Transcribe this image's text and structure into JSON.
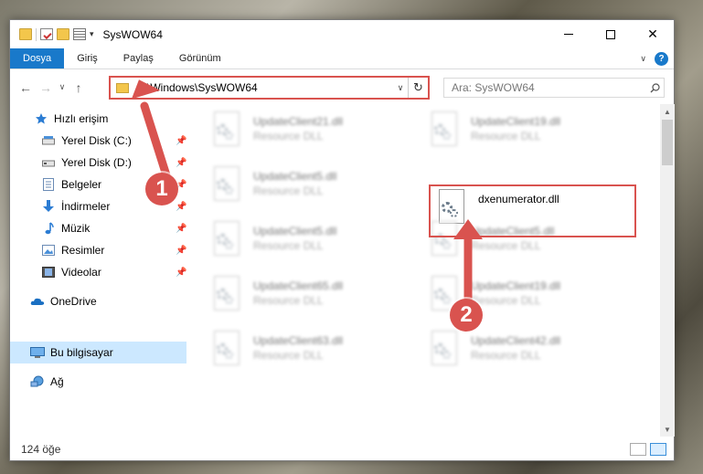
{
  "window": {
    "title": "SysWOW64",
    "controls": {
      "minimize": "—",
      "maximize": "☐",
      "close": "✕"
    }
  },
  "ribbon": {
    "tabs": [
      "Dosya",
      "Giriş",
      "Paylaş",
      "Görünüm"
    ],
    "help": "?"
  },
  "nav": {
    "address": "C:\\Windows\\SysWOW64",
    "search_placeholder": "Ara: SysWOW64"
  },
  "sidebar": {
    "items": [
      {
        "label": "Hızlı erişim",
        "icon": "star-icon"
      },
      {
        "label": "Yerel Disk (C:)",
        "icon": "drive-icon"
      },
      {
        "label": "Yerel Disk (D:)",
        "icon": "drive-icon"
      },
      {
        "label": "Belgeler",
        "icon": "documents-icon"
      },
      {
        "label": "İndirmeler",
        "icon": "downloads-icon"
      },
      {
        "label": "Müzik",
        "icon": "music-icon"
      },
      {
        "label": "Resimler",
        "icon": "pictures-icon"
      },
      {
        "label": "Videolar",
        "icon": "videos-icon"
      },
      {
        "label": "OneDrive",
        "icon": "onedrive-icon"
      },
      {
        "label": "Bu bilgisayar",
        "icon": "computer-icon"
      },
      {
        "label": "Ağ",
        "icon": "network-icon"
      }
    ]
  },
  "files": {
    "left": [
      {
        "name": "UpdateClient21.dll",
        "desc": "Resource DLL"
      },
      {
        "name": "UpdateClient5.dll",
        "desc": "Resource DLL"
      },
      {
        "name": "UpdateClient5.dll",
        "desc": "Resource DLL"
      },
      {
        "name": "UpdateClient65.dll",
        "desc": "Resource DLL"
      },
      {
        "name": "UpdateClient63.dll",
        "desc": "Resource DLL"
      }
    ],
    "right": [
      {
        "name": "UpdateClient19.dll",
        "desc": "Resource DLL"
      },
      {
        "name": "dxenumerator.dll",
        "desc": ""
      },
      {
        "name": "UpdateClient5.dll",
        "desc": "Resource DLL"
      },
      {
        "name": "UpdateClient19.dll",
        "desc": "Resource DLL"
      },
      {
        "name": "UpdateClient42.dll",
        "desc": "Resource DLL"
      }
    ]
  },
  "status": {
    "item_count": "124 öğe"
  },
  "annotations": {
    "step1": "1",
    "step2": "2",
    "color": "#d9534f"
  }
}
